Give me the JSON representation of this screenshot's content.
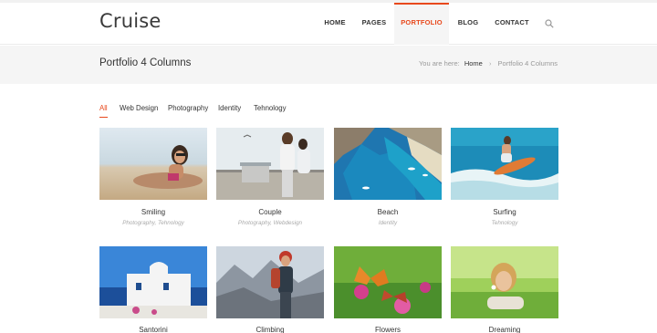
{
  "brand": {
    "logo": "Cruise",
    "accent": "#e8491d"
  },
  "nav": {
    "items": [
      {
        "label": "HOME"
      },
      {
        "label": "PAGES"
      },
      {
        "label": "PORTFOLIO"
      },
      {
        "label": "BLOG"
      },
      {
        "label": "CONTACT"
      }
    ],
    "active": "PORTFOLIO",
    "search_icon": "search-icon"
  },
  "titlebar": {
    "title": "Portfolio 4 Columns",
    "breadcrumb_prefix": "You are here:",
    "breadcrumb_home": "Home",
    "breadcrumb_sep": "›",
    "breadcrumb_current": "Portfolio 4 Columns"
  },
  "filters": {
    "items": [
      "All",
      "Web Design",
      "Photography",
      "Identity",
      "Tehnology"
    ],
    "active": "All"
  },
  "portfolio": {
    "items": [
      {
        "title": "Smiling",
        "tags": "Photography, Tehnology"
      },
      {
        "title": "Couple",
        "tags": "Photography, Webdesign"
      },
      {
        "title": "Beach",
        "tags": "Identity"
      },
      {
        "title": "Surfing",
        "tags": "Tehnology"
      },
      {
        "title": "Santorini",
        "tags": ""
      },
      {
        "title": "Climbing",
        "tags": ""
      },
      {
        "title": "Flowers",
        "tags": ""
      },
      {
        "title": "Dreaming",
        "tags": ""
      }
    ]
  }
}
